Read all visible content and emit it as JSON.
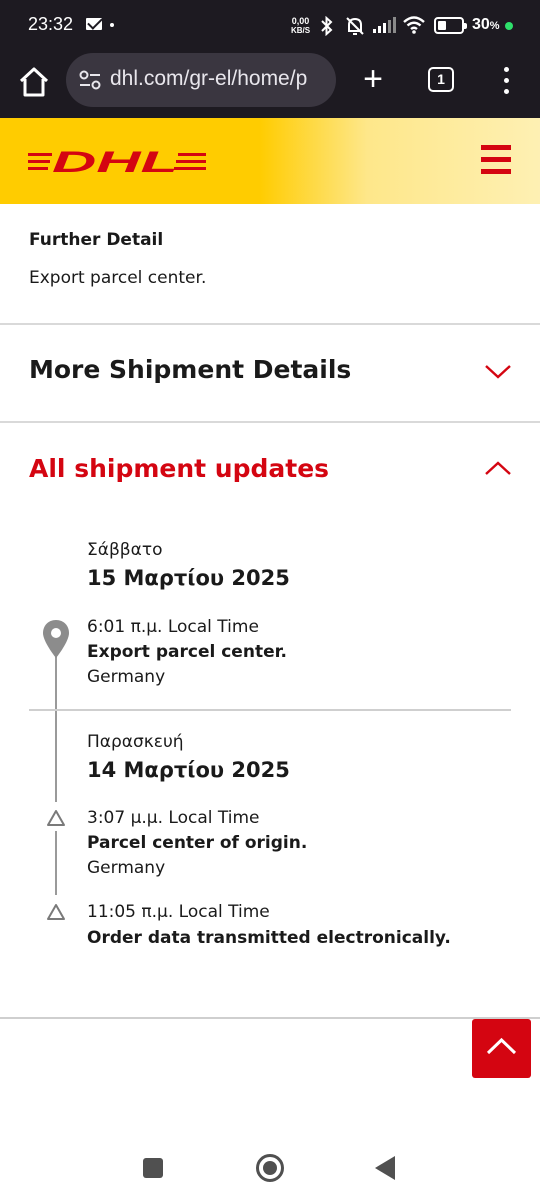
{
  "status_bar": {
    "time": "23:32",
    "net_speed_value": "0,00",
    "net_speed_unit": "KB/S",
    "battery_percent": "30",
    "battery_unit": "%"
  },
  "browser": {
    "url": "dhl.com/gr-el/home/p",
    "tab_count": "1"
  },
  "dhl": {
    "logo_text": "DHL",
    "brand_yellow": "#ffcc00",
    "brand_red": "#d40511"
  },
  "further_detail": {
    "title": "Further Detail",
    "text": "Export parcel center."
  },
  "sections": {
    "more_details": "More Shipment Details",
    "all_updates": "All shipment updates"
  },
  "timeline": {
    "days": [
      {
        "day_name": "Σάββατο",
        "date": "15 Μαρτίου 2025",
        "events": [
          {
            "time": "6:01 π.μ. Local Time",
            "description": "Export parcel center.",
            "location": "Germany",
            "icon": "location-pin-icon"
          }
        ]
      },
      {
        "day_name": "Παρασκευή",
        "date": "14 Μαρτίου 2025",
        "events": [
          {
            "time": "3:07 μ.μ. Local Time",
            "description": "Parcel center of origin.",
            "location": "Germany",
            "icon": "triangle-icon"
          },
          {
            "time": "11:05 π.μ. Local Time",
            "description": "Order data transmitted electronically.",
            "icon": "triangle-icon"
          }
        ]
      }
    ]
  }
}
